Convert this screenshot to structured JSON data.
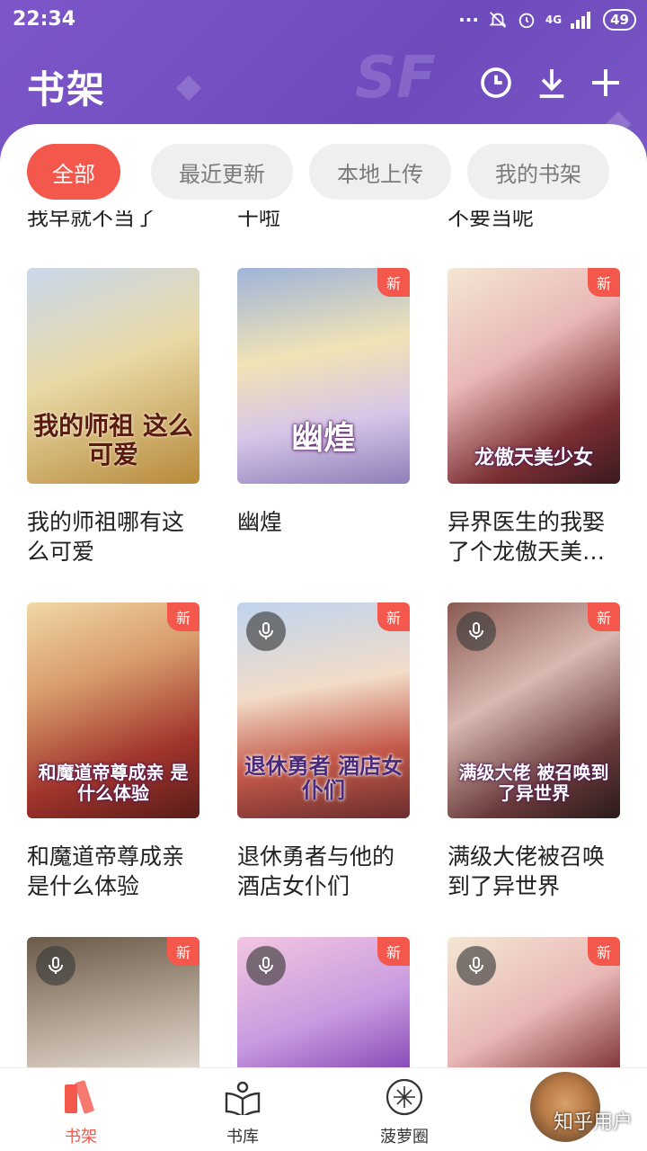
{
  "status_bar": {
    "time": "22:34",
    "network": "4G",
    "battery": "49"
  },
  "header": {
    "title": "书架"
  },
  "tabs": [
    {
      "label": "全部",
      "active": true
    },
    {
      "label": "最近更新",
      "active": false
    },
    {
      "label": "本地上传",
      "active": false
    },
    {
      "label": "我的书架",
      "active": false
    }
  ],
  "cut_titles": [
    "我早就不当了",
    "干啦",
    "不要当呢"
  ],
  "books": [
    {
      "title": "我的师祖哪有这么可爱",
      "is_new": false,
      "audio": false,
      "cover_text": "我的师祖 这么可爱"
    },
    {
      "title": "幽煌",
      "is_new": true,
      "audio": false,
      "cover_text": "幽煌"
    },
    {
      "title": "异界医生的我娶了个龙傲天美少女",
      "is_new": true,
      "audio": false,
      "cover_text": "龙傲天美少女"
    },
    {
      "title": "和魔道帝尊成亲是什么体验",
      "is_new": true,
      "audio": false,
      "cover_text": "和魔道帝尊成亲 是什么体验"
    },
    {
      "title": "退休勇者与他的酒店女仆们",
      "is_new": true,
      "audio": true,
      "cover_text": "退休勇者 酒店女仆们"
    },
    {
      "title": "满级大佬被召唤到了异世界",
      "is_new": true,
      "audio": true,
      "cover_text": "满级大佬 被召唤到了异世界"
    },
    {
      "title": "",
      "is_new": true,
      "audio": true,
      "cover_text": ""
    },
    {
      "title": "",
      "is_new": true,
      "audio": true,
      "cover_text": ""
    },
    {
      "title": "",
      "is_new": true,
      "audio": true,
      "cover_text": ""
    }
  ],
  "badge_label": "新",
  "bottom_nav": [
    {
      "label": "书架",
      "active": true
    },
    {
      "label": "书库",
      "active": false
    },
    {
      "label": "菠萝圈",
      "active": false
    }
  ],
  "watermark": "知乎用户",
  "colors": {
    "accent": "#f4574b",
    "header": "#7453c4"
  }
}
